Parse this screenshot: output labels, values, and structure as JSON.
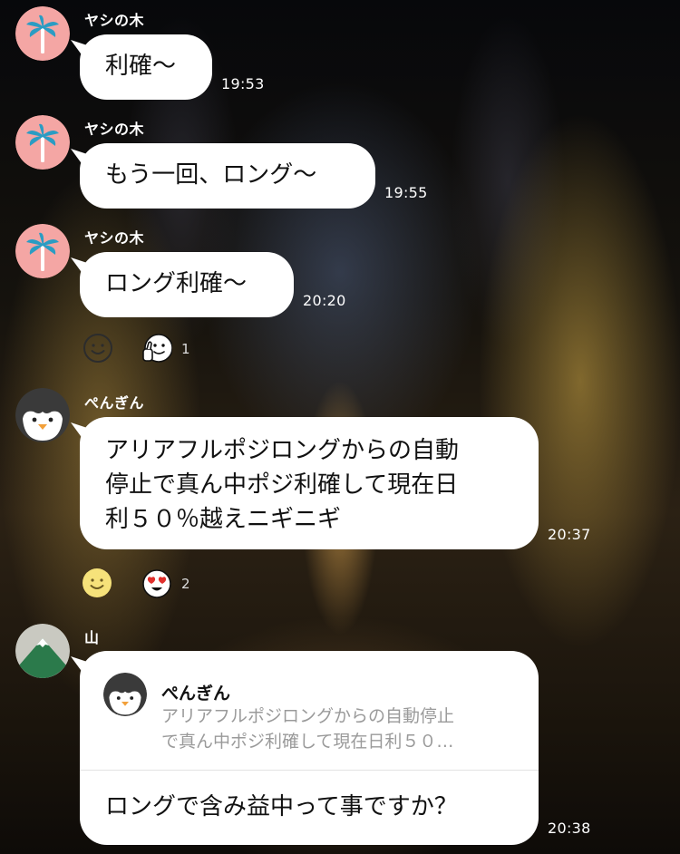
{
  "messages": [
    {
      "sender": "ヤシの木",
      "text": "利確〜",
      "time": "19:53",
      "avatar_icon": "palm-tree-icon"
    },
    {
      "sender": "ヤシの木",
      "text": "もう一回、ロング〜",
      "time": "19:55",
      "avatar_icon": "palm-tree-icon"
    },
    {
      "sender": "ヤシの木",
      "text": "ロング利確〜",
      "time": "20:20",
      "avatar_icon": "palm-tree-icon",
      "reactions": {
        "add_icon": "add-reaction-smile-icon",
        "icon": "thumbs-up-face-icon",
        "count": "1"
      }
    },
    {
      "sender": "ぺんぎん",
      "text": "アリアフルポジロングからの自動\n停止で真ん中ポジ利確して現在日\n利５０％越えニギニギ",
      "time": "20:37",
      "avatar_icon": "penguin-icon",
      "reactions": {
        "add_icon": "add-reaction-smile-icon",
        "icon": "heart-eyes-icon",
        "count": "2"
      }
    },
    {
      "sender": "山",
      "time": "20:38",
      "avatar_icon": "mountain-icon",
      "quote": {
        "name": "ぺんぎん",
        "text": "アリアフルポジロングからの自動停止\nで真ん中ポジ利確して現在日利５０…",
        "avatar_icon": "penguin-icon"
      },
      "text": "ロングで含み益中って事ですか？"
    }
  ],
  "colors": {
    "bubble": "#ffffff",
    "palm_avatar_bg": "#f4a6a4",
    "palm_leaves": "#2a9cc3",
    "mountain_avatar_bg": "#c9c9c1",
    "mountain": "#2b7a4b",
    "reaction_smile": "#f6e27a"
  }
}
